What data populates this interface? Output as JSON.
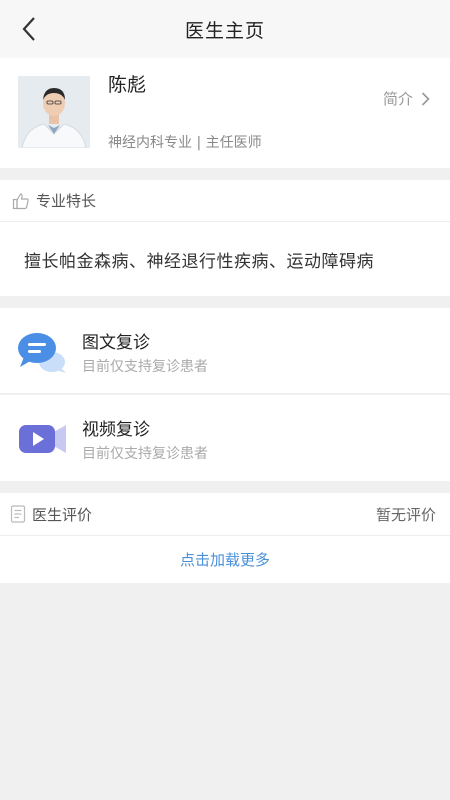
{
  "nav": {
    "title": "医生主页",
    "back_icon": "chevron-left-icon"
  },
  "doctor": {
    "name": "陈彪",
    "department": "神经内科专业",
    "title": "主任医师",
    "subtitle": "神经内科专业 | 主任医师",
    "intro_label": "简介"
  },
  "specialty": {
    "header": "专业特长",
    "icon": "thumbs-up-icon",
    "text": "擅长帕金森病、神经退行性疾病、运动障碍病"
  },
  "consultations": [
    {
      "title": "图文复诊",
      "desc": "目前仅支持复诊患者",
      "icon": "chat-bubble-icon"
    },
    {
      "title": "视频复诊",
      "desc": "目前仅支持复诊患者",
      "icon": "video-camera-icon"
    }
  ],
  "reviews": {
    "header": "医生评价",
    "icon": "document-icon",
    "status": "暂无评价",
    "load_more": "点击加载更多"
  },
  "colors": {
    "link": "#4a90d9",
    "chat_icon": "#4a8ee6",
    "video_icon": "#6b6fd8"
  }
}
